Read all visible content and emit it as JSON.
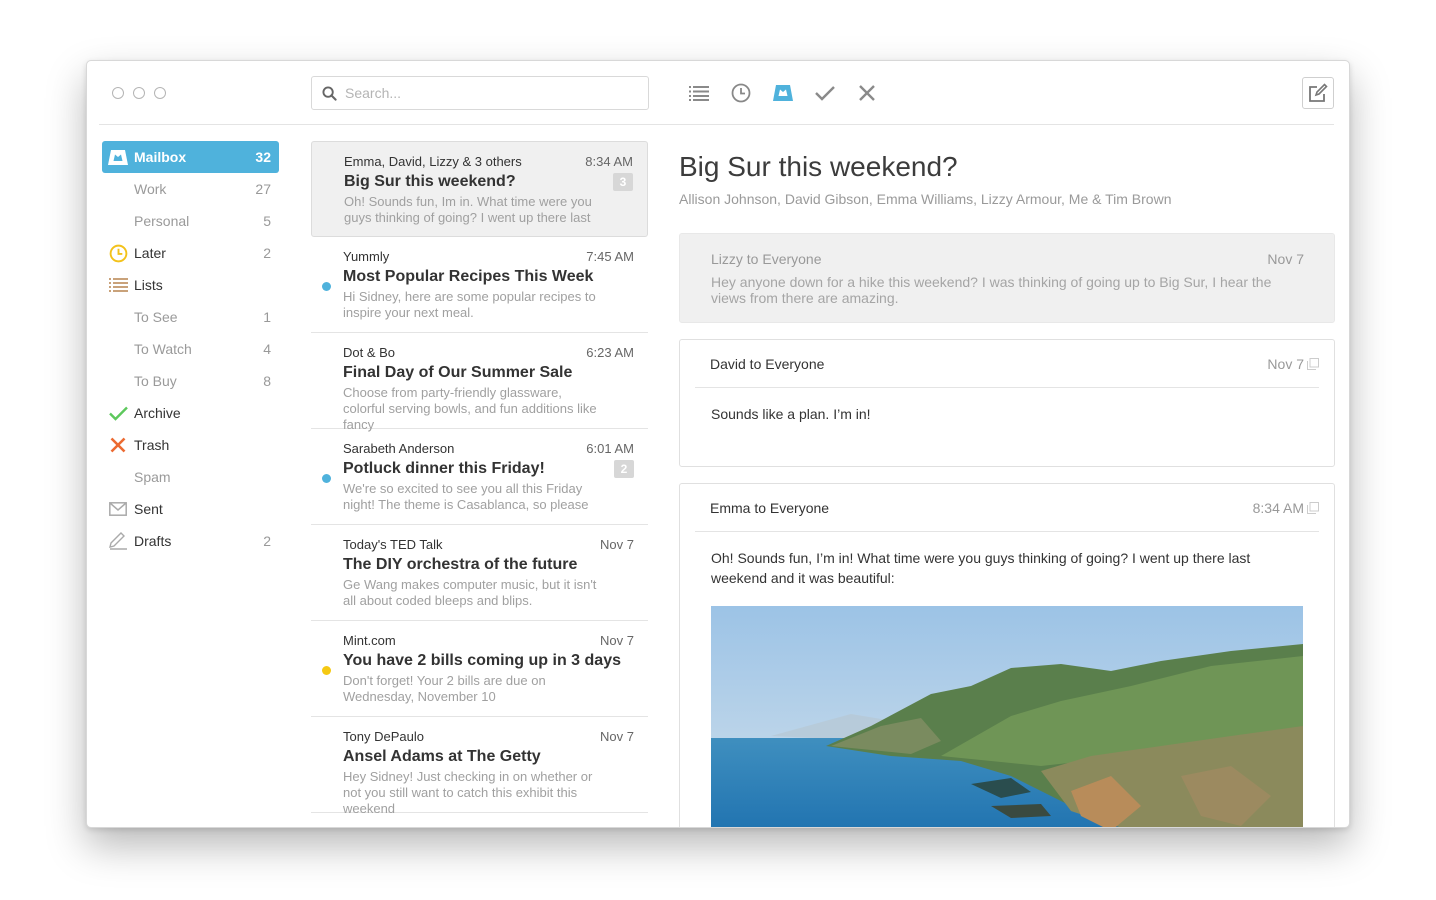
{
  "window": {
    "traffic_lights": [
      "close",
      "minimize",
      "zoom"
    ]
  },
  "search": {
    "placeholder": "Search...",
    "value": "",
    "icon": "search-icon"
  },
  "toolbar": {
    "actions": [
      {
        "name": "list",
        "icon": "list-icon"
      },
      {
        "name": "later",
        "icon": "clock-icon"
      },
      {
        "name": "mailbox",
        "icon": "mailbox-icon",
        "active": true
      },
      {
        "name": "archive",
        "icon": "check-icon"
      },
      {
        "name": "delete",
        "icon": "x-icon"
      }
    ],
    "compose_icon": "compose-icon"
  },
  "colors": {
    "accent": "#4fb2dc",
    "later": "#f3c21b",
    "lists": "#c9a27a",
    "archive": "#5dc85c",
    "trash": "#ec6a31",
    "unread_blue": "#4fb2dc",
    "unread_yellow": "#f5c913"
  },
  "sidebar": {
    "items": [
      {
        "label": "Mailbox",
        "count": "32",
        "icon": "mailbox-icon",
        "active": true
      },
      {
        "label": "Work",
        "count": "27",
        "sub": true
      },
      {
        "label": "Personal",
        "count": "5",
        "sub": true
      },
      {
        "label": "Later",
        "count": "2",
        "icon": "clock-icon"
      },
      {
        "label": "Lists",
        "count": "",
        "icon": "list-icon"
      },
      {
        "label": "To See",
        "count": "1",
        "sub": true
      },
      {
        "label": "To Watch",
        "count": "4",
        "sub": true
      },
      {
        "label": "To Buy",
        "count": "8",
        "sub": true
      },
      {
        "label": "Archive",
        "count": "",
        "icon": "check-icon"
      },
      {
        "label": "Trash",
        "count": "",
        "icon": "x-icon"
      },
      {
        "label": "Spam",
        "count": "",
        "sub": true
      },
      {
        "label": "Sent",
        "count": "",
        "icon": "envelope-icon"
      },
      {
        "label": "Drafts",
        "count": "2",
        "icon": "pencil-icon"
      }
    ]
  },
  "messages": [
    {
      "from": "Emma, David, Lizzy & 3 others",
      "time": "8:34 AM",
      "subject": "Big Sur this weekend?",
      "preview": "Oh! Sounds fun, Im in. What time were you guys thinking of going? I went up there last",
      "badge": "3",
      "selected": true,
      "dot": ""
    },
    {
      "from": "Yummly",
      "time": "7:45 AM",
      "subject": "Most Popular Recipes This Week",
      "preview": "Hi Sidney, here are some popular recipes to inspire your next meal.",
      "badge": "",
      "dot": "blue"
    },
    {
      "from": "Dot & Bo",
      "time": "6:23 AM",
      "subject": "Final Day of Our Summer Sale",
      "preview": "Choose from party-friendly glassware, colorful serving bowls, and fun additions like fancy",
      "badge": "",
      "dot": ""
    },
    {
      "from": "Sarabeth Anderson",
      "time": "6:01 AM",
      "subject": "Potluck dinner this Friday!",
      "preview": "We're so excited to see you all this Friday night! The theme is Casablanca, so please",
      "badge": "2",
      "dot": "blue"
    },
    {
      "from": "Today's TED Talk",
      "time": "Nov 7",
      "subject": "The DIY orchestra of the future",
      "preview": "Ge Wang makes computer music, but it isn't all about coded bleeps and blips.",
      "badge": "",
      "dot": ""
    },
    {
      "from": "Mint.com",
      "time": "Nov 7",
      "subject": "You have 2 bills coming up in 3 days",
      "preview": "Don't forget! Your 2 bills are due on Wednesday, November 10",
      "badge": "",
      "dot": "yellow"
    },
    {
      "from": "Tony DePaulo",
      "time": "Nov 7",
      "subject": "Ansel Adams at The Getty",
      "preview": "Hey Sidney! Just checking in on whether or not you still want to catch this exhibit this weekend",
      "badge": "",
      "dot": ""
    }
  ],
  "thread": {
    "title": "Big Sur this weekend?",
    "participants": "Allison Johnson, David Gibson, Emma Williams, Lizzy Armour, Me & Tim Brown",
    "messages": [
      {
        "header": "Lizzy to Everyone",
        "date": "Nov 7",
        "body": "Hey anyone down for a hike this weekend? I was thinking of going up to Big Sur, I hear the views from there are amazing.",
        "collapsed": true
      },
      {
        "header": "David to Everyone",
        "date": "Nov 7",
        "body": "Sounds like a plan. I’m in!",
        "collapsed": false
      },
      {
        "header": "Emma to Everyone",
        "date": "8:34 AM",
        "body": "Oh! Sounds fun, I’m in! What time were you guys thinking of going? I went up there last weekend and it was beautiful:",
        "collapsed": false,
        "attachment": "Big Sur coastline photo"
      }
    ]
  }
}
